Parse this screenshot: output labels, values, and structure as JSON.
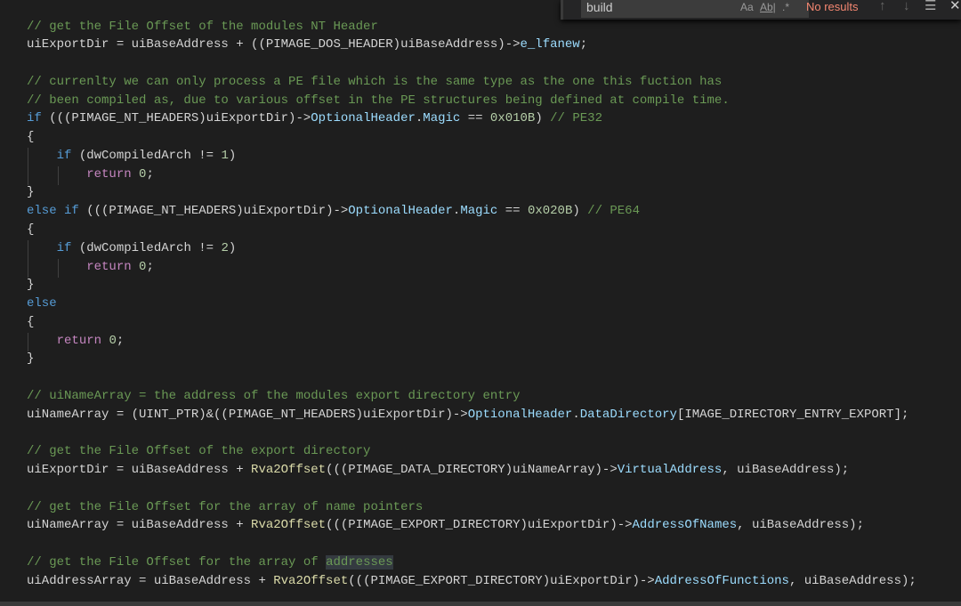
{
  "find_widget": {
    "query": "build",
    "match_case": "Aa",
    "whole_word": "Ab|",
    "regex": ".*",
    "status": "No results",
    "prev_icon": "arrow-up-icon",
    "next_icon": "arrow-down-icon",
    "selection_icon": "find-in-selection-icon",
    "close_icon": "close-icon"
  },
  "code": {
    "lines": [
      [
        [
          "// get the File Offset of the modules NT Header",
          "c"
        ]
      ],
      [
        [
          "uiExportDir = uiBaseAddress + ((PIMAGE_DOS_HEADER)uiBaseAddress)->",
          "t"
        ],
        [
          "e_lfanew",
          "v"
        ],
        [
          ";",
          "t"
        ]
      ],
      [],
      [
        [
          "// currenlty we can only process a PE file which is the same type as the one this fuction has",
          "c"
        ]
      ],
      [
        [
          "// been compiled as, due to various offset in the PE structures being defined at compile time.",
          "c"
        ]
      ],
      [
        [
          "if",
          "k"
        ],
        [
          " (((PIMAGE_NT_HEADERS)uiExportDir)->",
          "t"
        ],
        [
          "OptionalHeader",
          "v"
        ],
        [
          ".",
          "t"
        ],
        [
          "Magic",
          "v"
        ],
        [
          " == ",
          "t"
        ],
        [
          "0x010B",
          "n"
        ],
        [
          ") ",
          "t"
        ],
        [
          "// PE32",
          "c"
        ]
      ],
      [
        [
          "{",
          "t"
        ]
      ],
      [
        [
          "    ",
          "t"
        ],
        [
          "if",
          "k"
        ],
        [
          " (dwCompiledArch != ",
          "t"
        ],
        [
          "1",
          "n"
        ],
        [
          ")",
          "t"
        ]
      ],
      [
        [
          "        ",
          "t"
        ],
        [
          "return",
          "p"
        ],
        [
          " ",
          "t"
        ],
        [
          "0",
          "n"
        ],
        [
          ";",
          "t"
        ]
      ],
      [
        [
          "}",
          "t"
        ]
      ],
      [
        [
          "else",
          "k"
        ],
        [
          " ",
          "t"
        ],
        [
          "if",
          "k"
        ],
        [
          " (((PIMAGE_NT_HEADERS)uiExportDir)->",
          "t"
        ],
        [
          "OptionalHeader",
          "v"
        ],
        [
          ".",
          "t"
        ],
        [
          "Magic",
          "v"
        ],
        [
          " == ",
          "t"
        ],
        [
          "0x020B",
          "n"
        ],
        [
          ") ",
          "t"
        ],
        [
          "// PE64",
          "c"
        ]
      ],
      [
        [
          "{",
          "t"
        ]
      ],
      [
        [
          "    ",
          "t"
        ],
        [
          "if",
          "k"
        ],
        [
          " (dwCompiledArch != ",
          "t"
        ],
        [
          "2",
          "n"
        ],
        [
          ")",
          "t"
        ]
      ],
      [
        [
          "        ",
          "t"
        ],
        [
          "return",
          "p"
        ],
        [
          " ",
          "t"
        ],
        [
          "0",
          "n"
        ],
        [
          ";",
          "t"
        ]
      ],
      [
        [
          "}",
          "t"
        ]
      ],
      [
        [
          "else",
          "k"
        ]
      ],
      [
        [
          "{",
          "t"
        ]
      ],
      [
        [
          "    ",
          "t"
        ],
        [
          "return",
          "p"
        ],
        [
          " ",
          "t"
        ],
        [
          "0",
          "n"
        ],
        [
          ";",
          "t"
        ]
      ],
      [
        [
          "}",
          "t"
        ]
      ],
      [],
      [
        [
          "// uiNameArray = the address of the modules export directory entry",
          "c"
        ]
      ],
      [
        [
          "uiNameArray = (UINT_PTR)&((PIMAGE_NT_HEADERS)uiExportDir)->",
          "t"
        ],
        [
          "OptionalHeader",
          "v"
        ],
        [
          ".",
          "t"
        ],
        [
          "DataDirectory",
          "v"
        ],
        [
          "[IMAGE_DIRECTORY_ENTRY_EXPORT];",
          "t"
        ]
      ],
      [],
      [
        [
          "// get the File Offset of the export directory",
          "c"
        ]
      ],
      [
        [
          "uiExportDir = uiBaseAddress + ",
          "t"
        ],
        [
          "Rva2Offset",
          "f"
        ],
        [
          "(((PIMAGE_DATA_DIRECTORY)uiNameArray)->",
          "t"
        ],
        [
          "VirtualAddress",
          "v"
        ],
        [
          ", uiBaseAddress);",
          "t"
        ]
      ],
      [],
      [
        [
          "// get the File Offset for the array of name pointers",
          "c"
        ]
      ],
      [
        [
          "uiNameArray = uiBaseAddress + ",
          "t"
        ],
        [
          "Rva2Offset",
          "f"
        ],
        [
          "(((PIMAGE_EXPORT_DIRECTORY)uiExportDir)->",
          "t"
        ],
        [
          "AddressOfNames",
          "v"
        ],
        [
          ", uiBaseAddress);",
          "t"
        ]
      ],
      [],
      [
        [
          "// get the File Offset for the array of ",
          "c"
        ],
        [
          "addresses",
          "c hl"
        ]
      ],
      [
        [
          "uiAddressArray = uiBaseAddress + ",
          "t"
        ],
        [
          "Rva2Offset",
          "f"
        ],
        [
          "(((PIMAGE_EXPORT_DIRECTORY)uiExportDir)->",
          "t"
        ],
        [
          "AddressOfFunctions",
          "v"
        ],
        [
          ", uiBaseAddress);",
          "t"
        ]
      ]
    ]
  }
}
